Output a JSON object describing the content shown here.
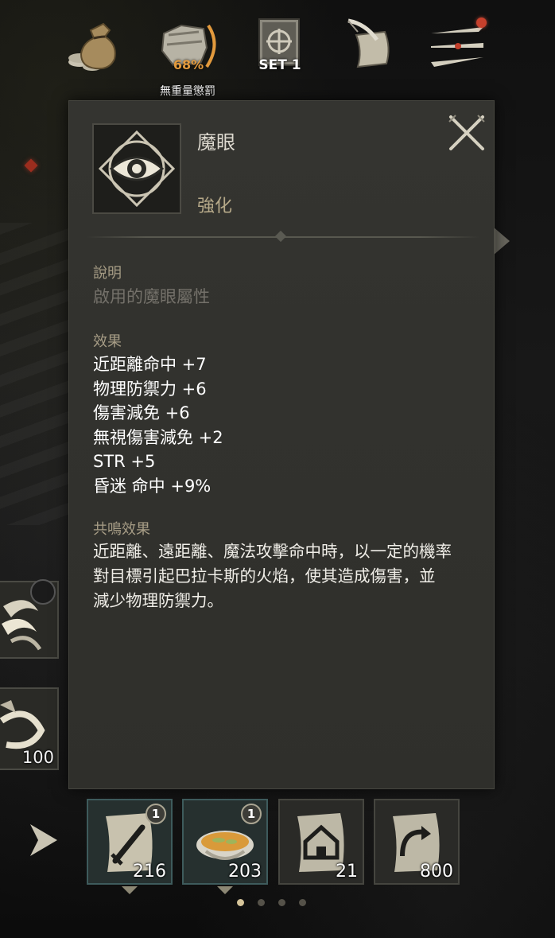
{
  "top_bar": {
    "weight_percent": "68%",
    "weight_label": "無重量懲罰",
    "equipment_set_label": "SET 1",
    "icons": [
      "gold-bag-icon",
      "inventory-bag-icon",
      "equipment-set-book-icon",
      "quest-scroll-icon",
      "menu-icon"
    ],
    "notification": true
  },
  "tooltip": {
    "item_name": "魔眼",
    "item_grade": "強化",
    "item_icon": "magic-eye-icon",
    "description_title": "說明",
    "description_text": "啟用的魔眼屬性",
    "effects_title": "效果",
    "effects": [
      "近距離命中 +7",
      "物理防禦力 +6",
      "傷害減免 +6",
      "無視傷害減免 +2",
      "STR +5",
      "昏迷 命中 +9%"
    ],
    "resonance_title": "共鳴效果",
    "resonance_lines": [
      "近距離、遠距離、魔法攻擊命中時，以一定的機率",
      "對目標引起巴拉卡斯的火焰，使其造成傷害，並",
      "減少物理防禦力。"
    ]
  },
  "side_skills": [
    {
      "icon": "claw-skill-icon",
      "count": ""
    },
    {
      "icon": "whirl-skill-icon",
      "count": "100"
    }
  ],
  "quick_slots": [
    {
      "icon": "sword-scroll-icon",
      "count": "216",
      "badge": "1",
      "highlighted": true
    },
    {
      "icon": "soup-bowl-icon",
      "count": "203",
      "badge": "1",
      "highlighted": true
    },
    {
      "icon": "return-home-scroll-icon",
      "count": "21",
      "badge": "",
      "highlighted": false
    },
    {
      "icon": "teleport-scroll-icon",
      "count": "800",
      "badge": "",
      "highlighted": false
    }
  ],
  "pagination": {
    "total": 4,
    "active": 0
  },
  "colors": {
    "panel": "#32322e",
    "grade": "#b6a989",
    "section_title": "#a79d86",
    "weight": "#e39a3d",
    "notification": "#c6402c"
  }
}
